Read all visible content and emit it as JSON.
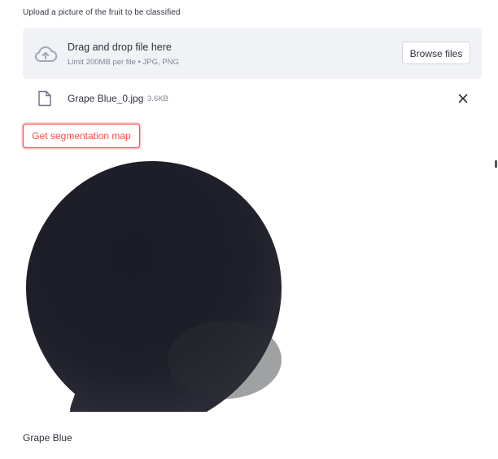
{
  "uploader": {
    "label": "Upload a picture of the fruit to be classified",
    "dropzone_title": "Drag and drop file here",
    "dropzone_subtitle": "Limit 200MB per file • JPG, PNG",
    "browse_label": "Browse files",
    "icon": "cloud-upload-icon"
  },
  "uploaded_file": {
    "name": "Grape Blue_0.jpg",
    "size": "3.6KB",
    "icon": "file-icon",
    "remove_icon": "close-icon"
  },
  "segmentation_button": {
    "label": "Get segmentation map"
  },
  "result": {
    "prediction": "Grape Blue"
  },
  "colors": {
    "accent": "#ff4b4b",
    "text": "#31333f",
    "muted": "#808495",
    "dropzone_bg": "#f0f2f6",
    "fruit": "#1d1e27"
  }
}
